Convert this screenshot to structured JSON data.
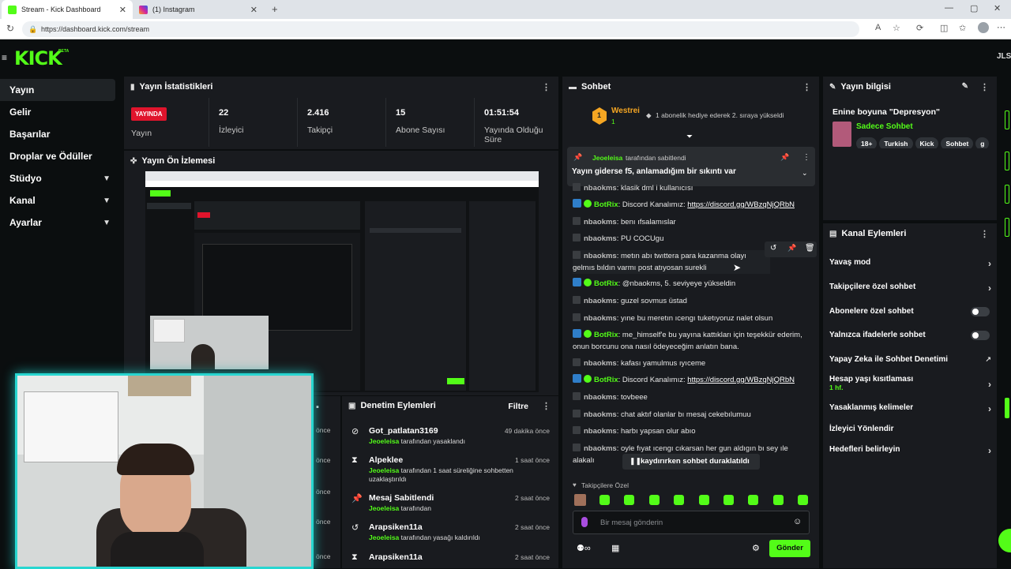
{
  "browser": {
    "tabs": [
      {
        "title": "Stream - Kick Dashboard",
        "active": true
      },
      {
        "title": "(1) Instagram",
        "active": false
      }
    ],
    "url": "https://dashboard.kick.com/stream"
  },
  "header": {
    "logo": "KICK",
    "beta": "BETA",
    "user_initials": "JLS"
  },
  "sidebar": {
    "items": [
      {
        "label": "Yayın",
        "active": true
      },
      {
        "label": "Gelir"
      },
      {
        "label": "Başarılar"
      },
      {
        "label": "Droplar ve Ödüller"
      },
      {
        "label": "Stüdyo",
        "chevron": true
      },
      {
        "label": "Kanal",
        "chevron": true
      },
      {
        "label": "Ayarlar",
        "chevron": true
      }
    ]
  },
  "stats": {
    "title": "Yayın İstatistikleri",
    "live_badge": "YAYINDA",
    "live_label": "Yayın",
    "items": [
      {
        "value": "22",
        "label": "İzleyici"
      },
      {
        "value": "2.416",
        "label": "Takipçi"
      },
      {
        "value": "15",
        "label": "Abone Sayısı"
      },
      {
        "value": "01:51:54",
        "label": "Yayında Olduğu Süre"
      }
    ]
  },
  "preview": {
    "title": "Yayın Ön İzlemesi"
  },
  "mod_actions": {
    "title": "Denetim Eylemleri",
    "filter": "Filtre",
    "partial_times": [
      "önce",
      "önce",
      "önce",
      "önce",
      "önce"
    ],
    "items": [
      {
        "title": "Got_patlatan3169",
        "actor": "Jeoeleisa",
        "desc": "tarafından yasaklandı",
        "time": "49 dakika önce",
        "icon": "ban-icon"
      },
      {
        "title": "Alpeklee",
        "actor": "Jeoeleisa",
        "desc": "tarafından 1 saat süreliğine sohbetten uzaklaştırıldı",
        "time": "1 saat önce",
        "icon": "hourglass-icon"
      },
      {
        "title": "Mesaj Sabitlendi",
        "actor": "Jeoeleisa",
        "desc": "tarafından",
        "time": "2 saat önce",
        "icon": "pin-icon"
      },
      {
        "title": "Arapsiken11a",
        "actor": "Jeoeleisa",
        "desc": "tarafından yasağı kaldırıldı",
        "time": "2 saat önce",
        "icon": "undo-icon"
      },
      {
        "title": "Arapsiken11a",
        "actor": "",
        "desc": "",
        "time": "2 saat önce",
        "icon": "hourglass-icon"
      }
    ]
  },
  "chat": {
    "title": "Sohbet",
    "top_gifter": {
      "name": "Westrei",
      "count": "1",
      "message": "1 abonelik hediye ederek 2. sıraya yükseldi"
    },
    "pinned": {
      "by": "Jeoeleisa",
      "by_suffix": "tarafından sabitlendi",
      "text": "Yayın giderse f5, anlamadığım bir sıkıntı var"
    },
    "messages": [
      {
        "type": "user",
        "user": "nbaokms",
        "text": "klasik dml i kullanıcısı"
      },
      {
        "type": "bot",
        "user": "BotRix",
        "text": "Discord Kanalımız: ",
        "link": "https://discord.gg/WBzqNjQRbN"
      },
      {
        "type": "user",
        "user": "nbaokms",
        "text": "benı ıfsalamıslar"
      },
      {
        "type": "user",
        "user": "nbaokms",
        "text": "PU COCUgu"
      },
      {
        "type": "user",
        "user": "nbaokms",
        "text": "metın abı twıttera para kazanma olayı gelmıs bıldın varmı post atıyosan surekli"
      },
      {
        "type": "bot",
        "user": "BotRix",
        "text": "@nbaokms, 5. seviyeye yükseldin"
      },
      {
        "type": "user",
        "user": "nbaokms",
        "text": "guzel sovmus üstad"
      },
      {
        "type": "user",
        "user": "nbaokms",
        "text": "yıne bu meretın ıcengı tuketıyoruz nalet olsun"
      },
      {
        "type": "bot",
        "user": "BotRix",
        "text": "me_himself'e bu yayına kattıkları için teşekkür ederim, onun borcunu ona nasıl ödeyeceğim anlatın bana."
      },
      {
        "type": "user",
        "user": "nbaokms",
        "text": "kafası yamulmus ıyıceme"
      },
      {
        "type": "bot",
        "user": "BotRix",
        "text": "Discord Kanalımız: ",
        "link": "https://discord.gg/WBzqNjQRbN"
      },
      {
        "type": "user",
        "user": "nbaokms",
        "text": "tovbeee"
      },
      {
        "type": "user",
        "user": "nbaokms",
        "text": "chat aktıf olanlar bı mesaj cekebılumuu"
      },
      {
        "type": "user",
        "user": "nbaokms",
        "text": "harbı yapsan olur abıo"
      },
      {
        "type": "user",
        "user": "nbaokms",
        "text": "oyle fıyat ıcengı cıkarsan her gun aldıgın bı sey ıle alakalı"
      }
    ],
    "paused": "kaydırırken sohbet duraklatıldı",
    "followers_only": "Takipçilere Özel",
    "input_placeholder": "Bir mesaj gönderin",
    "send": "Gönder",
    "action_icons": [
      "hourglass-icon",
      "pin-icon",
      "trash-icon"
    ]
  },
  "stream_info": {
    "title": "Yayın bilgisi",
    "stream_title": "Enine boyuna \"Depresyon\"",
    "category": "Sadece Sohbet",
    "tags": [
      "18+",
      "Turkish",
      "Kick",
      "Sohbet",
      "g"
    ]
  },
  "channel_actions": {
    "title": "Kanal Eylemleri",
    "items": [
      {
        "label": "Yavaş mod",
        "control": "arrow"
      },
      {
        "label": "Takipçilere özel sohbet",
        "control": "arrow"
      },
      {
        "label": "Abonelere özel sohbet",
        "control": "toggle"
      },
      {
        "label": "Yalnızca ifadelerle sohbet",
        "control": "toggle"
      },
      {
        "label": "Yapay Zeka ile Sohbet Denetimi",
        "control": "external"
      },
      {
        "label": "Hesap yaşı kısıtlaması",
        "sub": "1 hf.",
        "control": "arrow"
      },
      {
        "label": "Yasaklanmış kelimeler",
        "control": "arrow"
      },
      {
        "label": "İzleyici Yönlendir",
        "control": "none"
      },
      {
        "label": "Hedefleri belirleyin",
        "control": "arrow"
      }
    ]
  },
  "colors": {
    "accent": "#53fc18",
    "live": "#e0142c",
    "panel": "#191b1f",
    "bg": "#0b0e0f"
  }
}
